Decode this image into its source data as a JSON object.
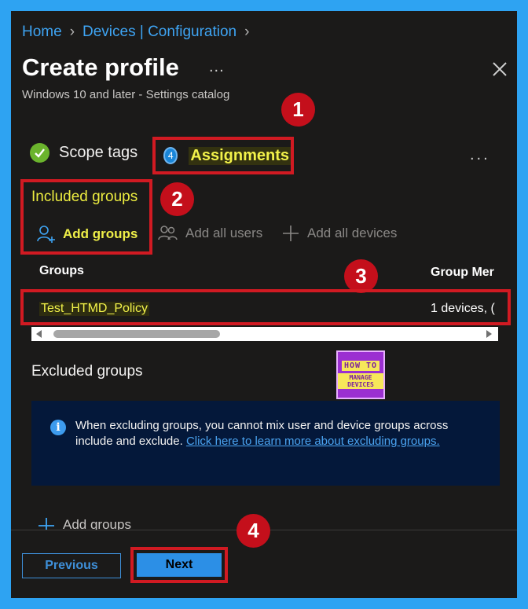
{
  "breadcrumb": {
    "home": "Home",
    "section": "Devices | Configuration"
  },
  "header": {
    "title": "Create profile",
    "title_more": "...",
    "subtitle": "Windows 10 and later - Settings catalog"
  },
  "tabs": {
    "scope_tags": {
      "label": "Scope tags",
      "state": "completed"
    },
    "assignments": {
      "number": "4",
      "label": "Assignments",
      "state": "active"
    },
    "more": "..."
  },
  "annotations": {
    "b1": "1",
    "b2": "2",
    "b3": "3",
    "b4": "4"
  },
  "included": {
    "title": "Included groups",
    "add_groups": "Add groups",
    "add_all_users": "Add all users",
    "add_all_devices": "Add all devices",
    "columns": [
      "Groups",
      "Group Mer"
    ],
    "rows": [
      {
        "group": "Test_HTMD_Policy",
        "members": "1 devices, ("
      }
    ]
  },
  "excluded": {
    "title": "Excluded groups",
    "info_text": "When excluding groups, you cannot mix user and device groups across include and exclude.",
    "info_link": "Click here to learn more about excluding groups.",
    "add_groups": "Add groups"
  },
  "logo": {
    "line1": "HOW TO",
    "line2": "MANAGE DEVICES"
  },
  "footer": {
    "previous": "Previous",
    "next": "Next"
  },
  "colors": {
    "frame": "#2ea3f2",
    "panel": "#1b1a19",
    "link": "#3ea4f3",
    "highlight": "#f2f24a",
    "annotation": "#c40f1b"
  }
}
